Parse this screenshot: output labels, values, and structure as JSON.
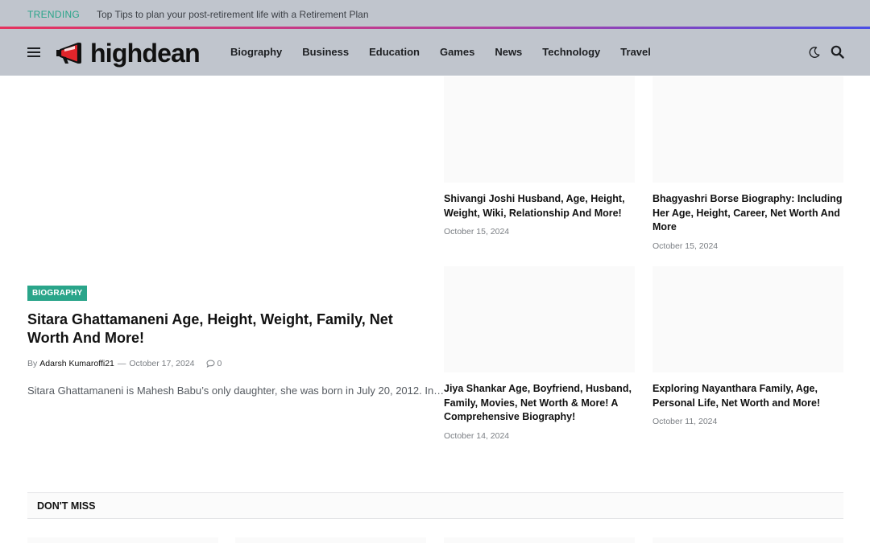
{
  "topbar": {
    "trending_label": "TRENDING",
    "ticker_text": "Top Tips to plan your post-retirement life with a Retirement Plan"
  },
  "header": {
    "logo_text": "highdean",
    "nav": [
      "Biography",
      "Business",
      "Education",
      "Games",
      "News",
      "Technology",
      "Travel"
    ],
    "icons": [
      "menu-icon",
      "moon-icon",
      "search-icon"
    ]
  },
  "feature": {
    "category": "BIOGRAPHY",
    "title": "Sitara Ghattamaneni Age, Height, Weight, Family, Net Worth And More!",
    "by": "By",
    "author": "Adarsh Kumaroffi21",
    "sep": "—",
    "date": "October 17, 2024",
    "comments": "0",
    "excerpt": "Sitara Ghattamaneni is Mahesh Babu’s only daughter, she was born in July 20, 2012. In…"
  },
  "cards": [
    {
      "title": "Shivangi Joshi Husband, Age, Height, Weight, Wiki, Relationship And More!",
      "date": "October 15, 2024"
    },
    {
      "title": "Bhagyashri Borse Biography: Including Her Age, Height, Career, Net Worth And More",
      "date": "October 15, 2024"
    },
    {
      "title": "Jiya Shankar Age, Boyfriend, Husband, Family, Movies, Net Worth & More! A Comprehensive Biography!",
      "date": "October 14, 2024"
    },
    {
      "title": "Exploring Nayanthara Family, Age, Personal Life, Net Worth and More!",
      "date": "October 11, 2024"
    }
  ],
  "sections": {
    "dont_miss": "DON'T MISS"
  },
  "colors": {
    "accent": "#2aa58a",
    "header_bg": "#c0c5cd",
    "gradient_start": "#e5325d",
    "gradient_end": "#4a4ee6"
  }
}
